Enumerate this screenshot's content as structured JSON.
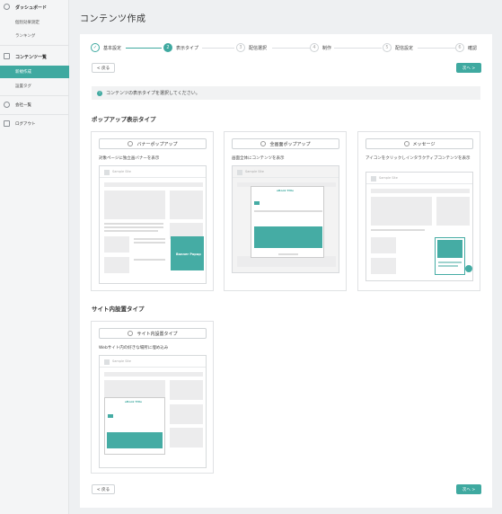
{
  "sidebar": {
    "items": [
      {
        "label": "ダッシュボード",
        "icon": "clock-icon"
      },
      {
        "label": "個別効果測定"
      },
      {
        "label": "ランキング"
      },
      {
        "label": "コンテンツ一覧",
        "icon": "document-icon"
      },
      {
        "label": "新規作成"
      },
      {
        "label": "設置タグ"
      },
      {
        "label": "会社一覧",
        "icon": "people-icon"
      },
      {
        "label": "ログアウト",
        "icon": "logout-icon"
      }
    ]
  },
  "header": {
    "title": "コンテンツ作成"
  },
  "steps": [
    {
      "num": "✓",
      "label": "基本設定"
    },
    {
      "num": "2",
      "label": "表示タイプ"
    },
    {
      "num": "3",
      "label": "配信選択"
    },
    {
      "num": "4",
      "label": "制作"
    },
    {
      "num": "5",
      "label": "配信設定"
    },
    {
      "num": "6",
      "label": "確認"
    }
  ],
  "nav": {
    "back_label": "< 戻る",
    "next_label": "次へ >"
  },
  "notice": {
    "icon": "!",
    "text": "コンテンツの表示タイプを選択してください。"
  },
  "popup_section": {
    "title": "ポップアップ表示タイプ",
    "cards": [
      {
        "option": "バナーポップアップ",
        "desc": "対象ページに独立画バナーを表示",
        "popup_label": "Banner Popup",
        "site": "Sample Site"
      },
      {
        "option": "全画面ポップアップ",
        "desc": "画面全体にコンテンツを表示",
        "popup_title": "eBook Title",
        "site": "Sample Site"
      },
      {
        "option": "メッセージ",
        "desc": "アイコンをクリックしインタラクティブコンテンツを表示",
        "site": "Sample Site"
      }
    ]
  },
  "inline_section": {
    "title": "サイト内設置タイプ",
    "cards": [
      {
        "option": "サイト内設置タイプ",
        "desc": "Webサイト内の好きな場所に埋め込み",
        "site": "Sample Site",
        "popup_title": "eBook Title"
      }
    ]
  },
  "colors": {
    "accent": "#3fa9a0"
  }
}
